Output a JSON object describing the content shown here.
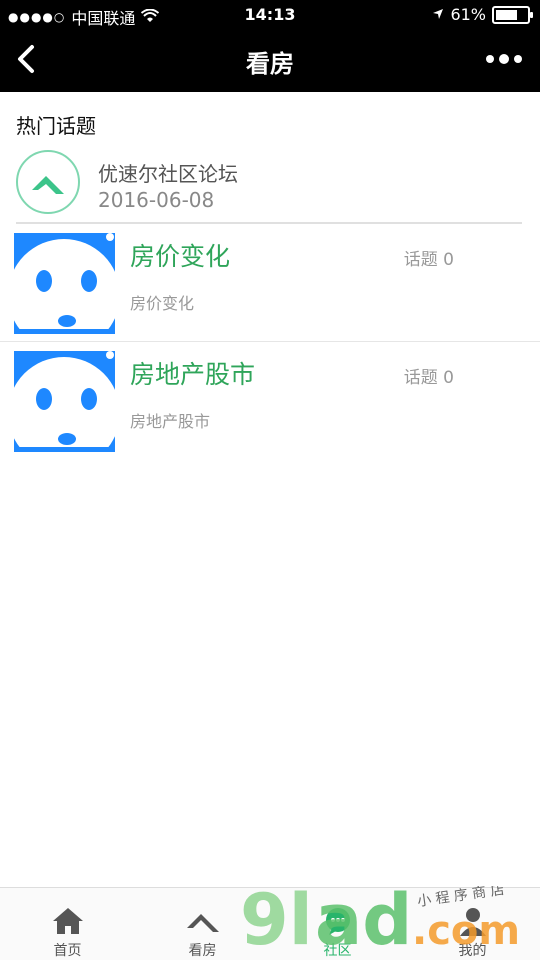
{
  "status_bar": {
    "carrier": "中国联通",
    "time": "14:13",
    "battery_percent": "61%"
  },
  "nav": {
    "title": "看房"
  },
  "section": {
    "title": "热门话题"
  },
  "forum": {
    "name": "优速尔社区论坛",
    "date": "2016-06-08"
  },
  "topics": [
    {
      "title": "房价变化",
      "count": "话题 0",
      "subtitle": "房价变化"
    },
    {
      "title": "房地产股市",
      "count": "话题 0",
      "subtitle": "房地产股市"
    }
  ],
  "tabs": [
    {
      "label": "首页"
    },
    {
      "label": "看房"
    },
    {
      "label": "社区"
    },
    {
      "label": "我的"
    }
  ],
  "watermark": {
    "text": "9lad.com",
    "tagline": "小程序商店"
  },
  "colors": {
    "accent_green": "#2fa55a",
    "tab_active": "#28b46b",
    "thumb_blue": "#1e90ff"
  }
}
